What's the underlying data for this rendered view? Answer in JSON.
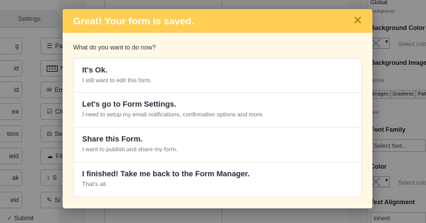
{
  "background": {
    "left_panel": {
      "settings_tab": "Settings",
      "buttons_left": [
        "g",
        "ld",
        "ld",
        "ea",
        "tons",
        "ield",
        "ak",
        "eld"
      ],
      "buttons_right": [
        {
          "label": "Pa",
          "icon": "paragraph-icon"
        },
        {
          "label": "Nu",
          "icon": "number-icon"
        },
        {
          "label": "Em",
          "icon": "email-icon"
        },
        {
          "label": "Ch",
          "icon": "checkbox-icon"
        },
        {
          "label": "Se",
          "icon": "select-icon"
        },
        {
          "label": "Fil",
          "icon": "file-upload-icon"
        },
        {
          "label": "S",
          "icon": "spacer-icon"
        },
        {
          "label": "Si",
          "icon": "signature-icon"
        }
      ],
      "submit": "Submit"
    },
    "right_panel": {
      "global": "Global",
      "background_small": "Background",
      "background_color": "Background Color",
      "select_color": "Select colo",
      "background_image": "Background Image /",
      "none": "None",
      "image_tabs": [
        "Images",
        "Gradients",
        "Patt"
      ],
      "text_small": "Text",
      "font_family": "Font Family",
      "select_font": "Select font...",
      "color": "Color",
      "select_color2": "Select colo",
      "text_alignment": "Text Alignment",
      "inherit": "inherit"
    }
  },
  "modal": {
    "title": "Great! Your form is saved.",
    "close_icon": "close-icon",
    "prompt": "What do you want to do now?",
    "options": [
      {
        "title": "It's Ok.",
        "description": "I still want to edit this form."
      },
      {
        "title": "Let's go to Form Settings.",
        "description": "I need to setup my email notifications, confirmation options and more."
      },
      {
        "title": "Share this Form.",
        "description": "I want to publish and share my form."
      },
      {
        "title": "I finished! Take me back to the Form Manager.",
        "description": "That's all."
      }
    ]
  },
  "colors": {
    "header": "#ffce52",
    "modal_body": "#fff8e4",
    "overlay": "rgba(0,0,0,0.43)"
  }
}
